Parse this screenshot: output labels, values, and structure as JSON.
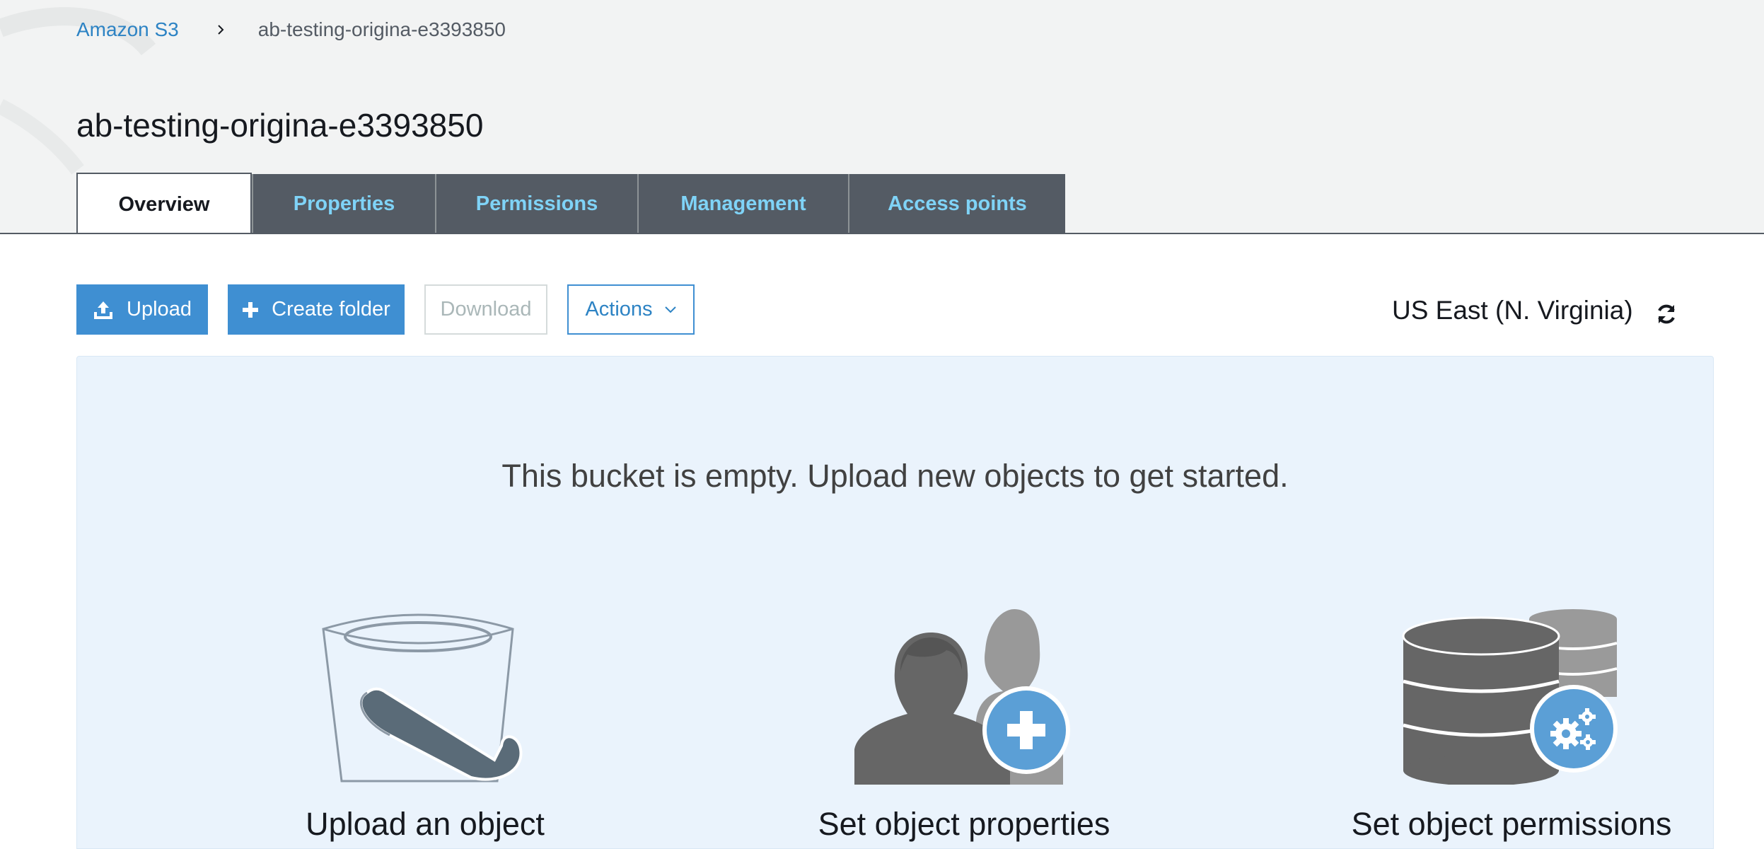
{
  "breadcrumb": {
    "root": "Amazon S3",
    "current": "ab-testing-origina-e3393850"
  },
  "page": {
    "title": "ab-testing-origina-e3393850"
  },
  "tabs": [
    {
      "label": "Overview",
      "active": true
    },
    {
      "label": "Properties",
      "active": false
    },
    {
      "label": "Permissions",
      "active": false
    },
    {
      "label": "Management",
      "active": false
    },
    {
      "label": "Access points",
      "active": false
    }
  ],
  "toolbar": {
    "upload_label": "Upload",
    "create_folder_label": "Create folder",
    "download_label": "Download",
    "actions_label": "Actions",
    "region": "US East (N. Virginia)"
  },
  "empty_state": {
    "message": "This bucket is empty. Upload new objects to get started.",
    "cards": [
      {
        "title": "Upload an object",
        "icon": "bucket-icon"
      },
      {
        "title": "Set object properties",
        "icon": "users-add-icon"
      },
      {
        "title": "Set object permissions",
        "icon": "database-settings-icon"
      }
    ]
  },
  "colors": {
    "primary": "#3f8fd2",
    "link": "#2d83c4",
    "tab_inactive_bg": "#545b64",
    "tab_inactive_text": "#7fd3f7",
    "panel_bg": "#eaf3fc"
  }
}
